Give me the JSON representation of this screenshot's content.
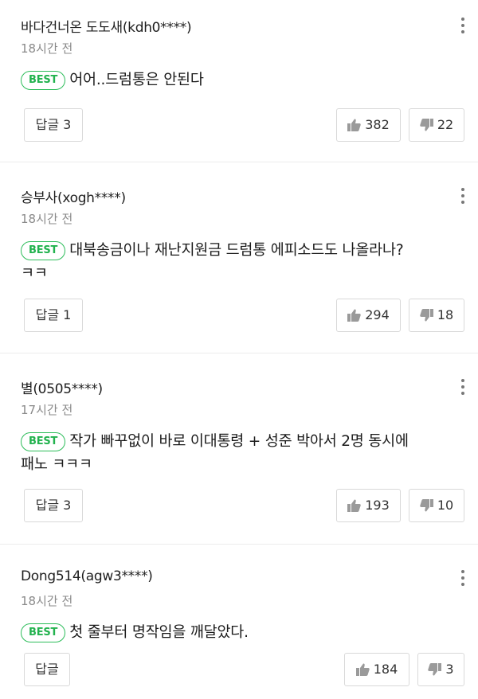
{
  "best_label": "BEST",
  "colors": {
    "best_green": "#2dbd5a",
    "icon_gray": "#9a9a9a"
  },
  "icons": {
    "like": "thumbs-up-icon",
    "dislike": "thumbs-down-icon",
    "more": "more-vertical-icon"
  },
  "comments": [
    {
      "author": "바다건너온 도도새(kdh0****)",
      "time": "18시간 전",
      "best": true,
      "text_lines": [
        "어어..드럼통은 안된다"
      ],
      "reply_label": "답글 3",
      "likes": "382",
      "dislikes": "22"
    },
    {
      "author": "승부사(xogh****)",
      "time": "18시간 전",
      "best": true,
      "text_lines": [
        "대북송금이나 재난지원금 드럼통 에피소드도 나올라나?",
        "ㅋㅋ"
      ],
      "reply_label": "답글 1",
      "likes": "294",
      "dislikes": "18"
    },
    {
      "author": "별(0505****)",
      "time": "17시간 전",
      "best": true,
      "text_lines": [
        "작가 빠꾸없이 바로 이대통령 + 성준 박아서 2명 동시에",
        "패노 ㅋㅋㅋ"
      ],
      "reply_label": "답글 3",
      "likes": "193",
      "dislikes": "10"
    },
    {
      "author": "Dong514(agw3****)",
      "time": "18시간 전",
      "best": true,
      "text_lines": [
        "첫 줄부터 명작임을 깨달았다."
      ],
      "reply_label": "답글",
      "likes": "184",
      "dislikes": "3"
    }
  ]
}
